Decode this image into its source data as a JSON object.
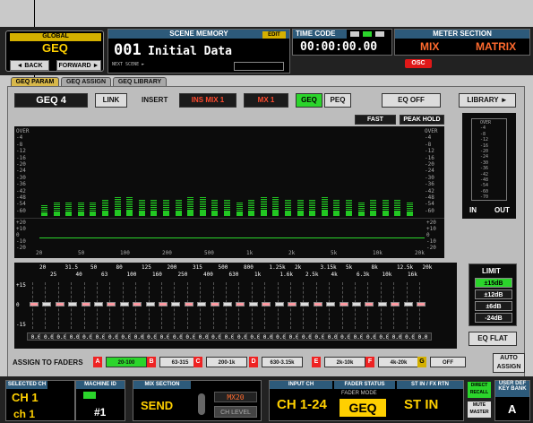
{
  "header": {
    "global_label": "GLOBAL",
    "global_value": "GEQ",
    "back_label": "◄ BACK",
    "forward_label": "FORWARD ►",
    "scene_memory_label": "SCENE MEMORY",
    "edit_badge": "EDIT",
    "scene_number": "001",
    "scene_name": "Initial Data",
    "next_scene_label": "NEXT SCENE ►",
    "time_code_label": "TIME CODE",
    "time_code_value": "00:00:00.00",
    "meter_section_label": "METER SECTION",
    "meter_mix": "MIX",
    "meter_matrix": "MATRIX",
    "osc_label": "OSC"
  },
  "tabs": [
    {
      "label": "GEQ PARAM",
      "active": true
    },
    {
      "label": "GEQ ASSIGN",
      "active": false
    },
    {
      "label": "GEQ LIBRARY",
      "active": false
    }
  ],
  "toolbar": {
    "geq_select": "GEQ 4",
    "link_label": "LINK",
    "insert_label": "INSERT",
    "insert_value": "INS MIX 1",
    "mix_value": "MX 1",
    "geq_btn": "GEQ",
    "peq_btn": "PEQ",
    "eq_off": "EQ OFF",
    "library": "LIBRARY ►",
    "fast": "FAST",
    "peak_hold": "PEAK HOLD"
  },
  "graph": {
    "db_labels": [
      "OVER",
      "-4",
      "-8",
      "-12",
      "-16",
      "-20",
      "-24",
      "-30",
      "-36",
      "-42",
      "-48",
      "-54",
      "-60"
    ],
    "curve_labels": [
      "+20",
      "+10",
      "0",
      "-10",
      "-20"
    ],
    "freq_labels": [
      "20",
      "50",
      "100",
      "200",
      "500",
      "1k",
      "2k",
      "5k",
      "10k",
      "20k"
    ],
    "levels": [
      4,
      5,
      5,
      5,
      5,
      6,
      7,
      7,
      6,
      6,
      6,
      6,
      7,
      7,
      6,
      6,
      5,
      6,
      7,
      7,
      6,
      6,
      6,
      7,
      6,
      6,
      5,
      6,
      6,
      6,
      5
    ]
  },
  "meter": {
    "in_label": "IN",
    "out_label": "OUT",
    "scale": [
      "OVER",
      "-4",
      "-8",
      "-12",
      "-16",
      "-20",
      "-24",
      "-30",
      "-36",
      "-42",
      "-48",
      "-54",
      "-60",
      "-70"
    ]
  },
  "faders": {
    "bands_top": [
      "20",
      "31.5",
      "50",
      "80",
      "125",
      "200",
      "315",
      "500",
      "800",
      "1.25k",
      "2k",
      "3.15k",
      "5k",
      "8k",
      "12.5k",
      "20k"
    ],
    "bands_bottom": [
      "25",
      "40",
      "63",
      "100",
      "160",
      "250",
      "400",
      "630",
      "1k",
      "1.6k",
      "2.5k",
      "4k",
      "6.3k",
      "10k",
      "16k"
    ],
    "scale": [
      "+15",
      "0",
      "-15"
    ],
    "values": [
      "0.0",
      "0.0",
      "0.0",
      "0.0",
      "0.0",
      "0.0",
      "0.0",
      "0.0",
      "0.0",
      "0.0",
      "0.0",
      "0.0",
      "0.0",
      "0.0",
      "0.0",
      "0.0",
      "0.0",
      "0.0",
      "0.0",
      "0.0",
      "0.0",
      "0.0",
      "0.0",
      "0.0",
      "0.0",
      "0.0",
      "0.0",
      "0.0",
      "0.0",
      "0.0",
      "0.0"
    ]
  },
  "limit": {
    "label": "LIMIT",
    "options": [
      "±15dB",
      "±12dB",
      "±6dB",
      "-24dB"
    ],
    "eq_flat": "EQ FLAT"
  },
  "assign": {
    "label": "ASSIGN TO FADERS",
    "ranges": [
      "20-100",
      "63-315",
      "200-1k",
      "630-3.15k",
      "2k-10k",
      "4k-20k",
      "OFF"
    ],
    "icons": [
      "A",
      "B",
      "C",
      "D",
      "E",
      "F",
      "G"
    ],
    "auto_assign": "AUTO ASSIGN"
  },
  "bottom": {
    "selected_ch_label": "SELECTED CH",
    "machine_id_label": "MACHINE ID",
    "channel": "CH 1",
    "channel_name": "ch 1",
    "machine_id": "#1",
    "mix_section_label": "MIX SECTION",
    "send_label": "SEND",
    "mix_name": "MX20",
    "ch_level": "CH LEVEL",
    "input_ch_label": "INPUT CH",
    "fader_status_label": "FADER STATUS",
    "st_in_label": "ST IN / FX RTN",
    "input_range": "CH 1-24",
    "fader_mode": "FADER MODE",
    "geq_value": "GEQ",
    "st_in_value": "ST IN",
    "direct_recall": "DIRECT RECALL",
    "mute_master": "MUTE MASTER",
    "user_def_label": "USER DEF KEY BANK",
    "user_def_value": "A"
  },
  "colors": {
    "accent": "#ffd000",
    "meter": "#22c722",
    "selection": "#2bd52b",
    "panel": "#2d5a7a",
    "alert": "#ff4a2e"
  }
}
